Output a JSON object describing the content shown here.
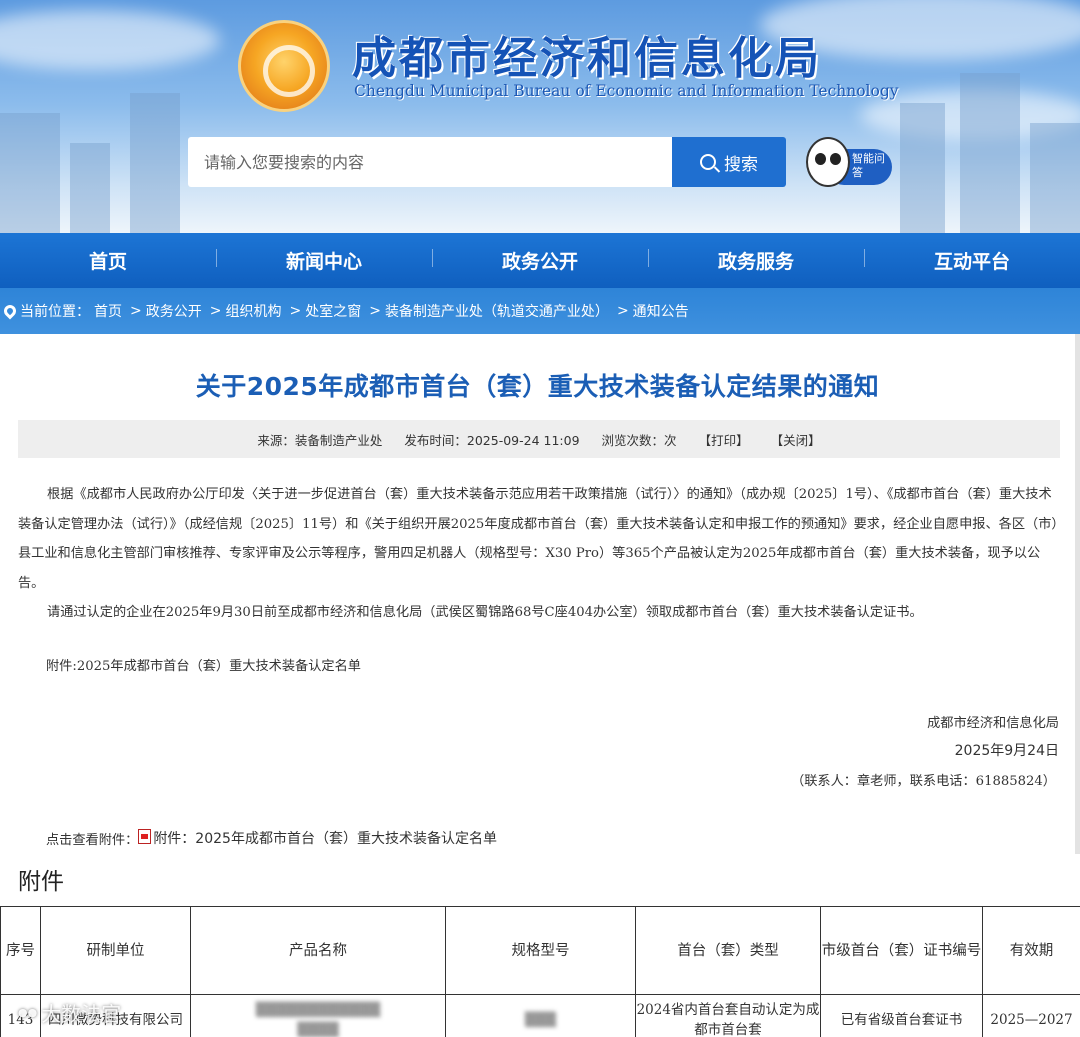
{
  "header": {
    "title": "成都市经济和信息化局",
    "subtitle": "Chengdu Municipal Bureau of Economic and Information Technology",
    "search_placeholder": "请输入您要搜索的内容",
    "search_button": "搜索",
    "assistant_label": "智能问答"
  },
  "nav": {
    "items": [
      "首页",
      "新闻中心",
      "政务公开",
      "政务服务",
      "互动平台"
    ]
  },
  "breadcrumb": {
    "label": "当前位置：",
    "items": [
      "首页",
      "政务公开",
      "组织机构",
      "处室之窗",
      "装备制造产业处（轨道交通产业处）",
      "通知公告"
    ],
    "separator": ">"
  },
  "article": {
    "title": "关于2025年成都市首台（套）重大技术装备认定结果的通知",
    "meta": {
      "source": "来源：装备制造产业处",
      "publish_time": "发布时间：2025-09-24 11:09",
      "views": "浏览次数：次",
      "print": "【打印】",
      "close": "【关闭】"
    },
    "paragraphs": [
      "根据《成都市人民政府办公厅印发〈关于进一步促进首台（套）重大技术装备示范应用若干政策措施（试行）〉的通知》（成办规〔2025〕1号）、《成都市首台（套）重大技术装备认定管理办法（试行）》（成经信规〔2025〕11号）和《关于组织开展2025年度成都市首台（套）重大技术装备认定和申报工作的预通知》要求，经企业自愿申报、各区（市）县工业和信息化主管部门审核推荐、专家评审及公示等程序，警用四足机器人（规格型号：X30 Pro）等365个产品被认定为2025年成都市首台（套）重大技术装备，现予以公告。",
      "请通过认定的企业在2025年9月30日前至成都市经济和信息化局（武侯区蜀锦路68号C座404办公室）领取成都市首台（套）重大技术装备认定证书。"
    ],
    "attachment_note": "附件:2025年成都市首台（套）重大技术装备认定名单",
    "signature_org": "成都市经济和信息化局",
    "signature_date": "2025年9月24日",
    "contact": "（联系人：章老师，联系电话：61885824）",
    "attach_prefix": "点击查看附件：",
    "attach_link": "附件：2025年成都市首台（套）重大技术装备认定名单"
  },
  "annex": {
    "heading": "附件",
    "columns": [
      "序号",
      "研制单位",
      "产品名称",
      "规格型号",
      "首台（套）类型",
      "市级首台（套）证书编号",
      "有效期"
    ],
    "rows": [
      [
        "143",
        "四川微势科技有限公司",
        "",
        "",
        "2024省内首台套自动认定为成都市首台套",
        "已有省级首台套证书",
        "2025—2027"
      ]
    ]
  },
  "watermark": "大数法官"
}
